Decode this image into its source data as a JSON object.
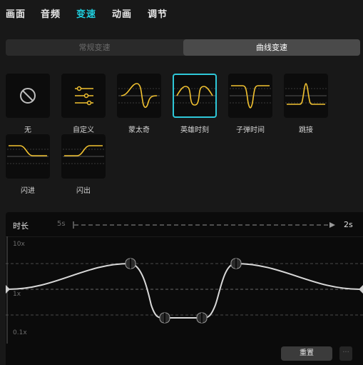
{
  "tabs": [
    {
      "label": "画面",
      "active": false
    },
    {
      "label": "音频",
      "active": false
    },
    {
      "label": "变速",
      "active": true
    },
    {
      "label": "动画",
      "active": false
    },
    {
      "label": "调节",
      "active": false
    }
  ],
  "speed_mode": {
    "normal_label": "常规变速",
    "curve_label": "曲线变速",
    "selected": "curve"
  },
  "presets": [
    {
      "id": "none",
      "label": "无",
      "icon": "no-entry-icon"
    },
    {
      "id": "custom",
      "label": "自定义",
      "icon": "sliders-icon"
    },
    {
      "id": "montage",
      "label": "蒙太奇",
      "icon": "montage-curve-icon"
    },
    {
      "id": "hero",
      "label": "英雄时刻",
      "icon": "hero-moment-curve-icon",
      "selected": true
    },
    {
      "id": "bullet",
      "label": "子弹时间",
      "icon": "bullet-time-curve-icon"
    },
    {
      "id": "jump",
      "label": "跳接",
      "icon": "jump-cut-curve-icon"
    },
    {
      "id": "flash_in",
      "label": "闪进",
      "icon": "flash-in-curve-icon"
    },
    {
      "id": "flash_out",
      "label": "闪出",
      "icon": "flash-out-curve-icon"
    }
  ],
  "duration": {
    "label": "时长",
    "original": "5s",
    "result": "2s"
  },
  "curve_editor": {
    "y_labels": [
      "10x",
      "1x",
      "0.1x"
    ],
    "accent_color": "#f2c230"
  },
  "actions": {
    "reset_label": "重置",
    "more_label": "···"
  }
}
